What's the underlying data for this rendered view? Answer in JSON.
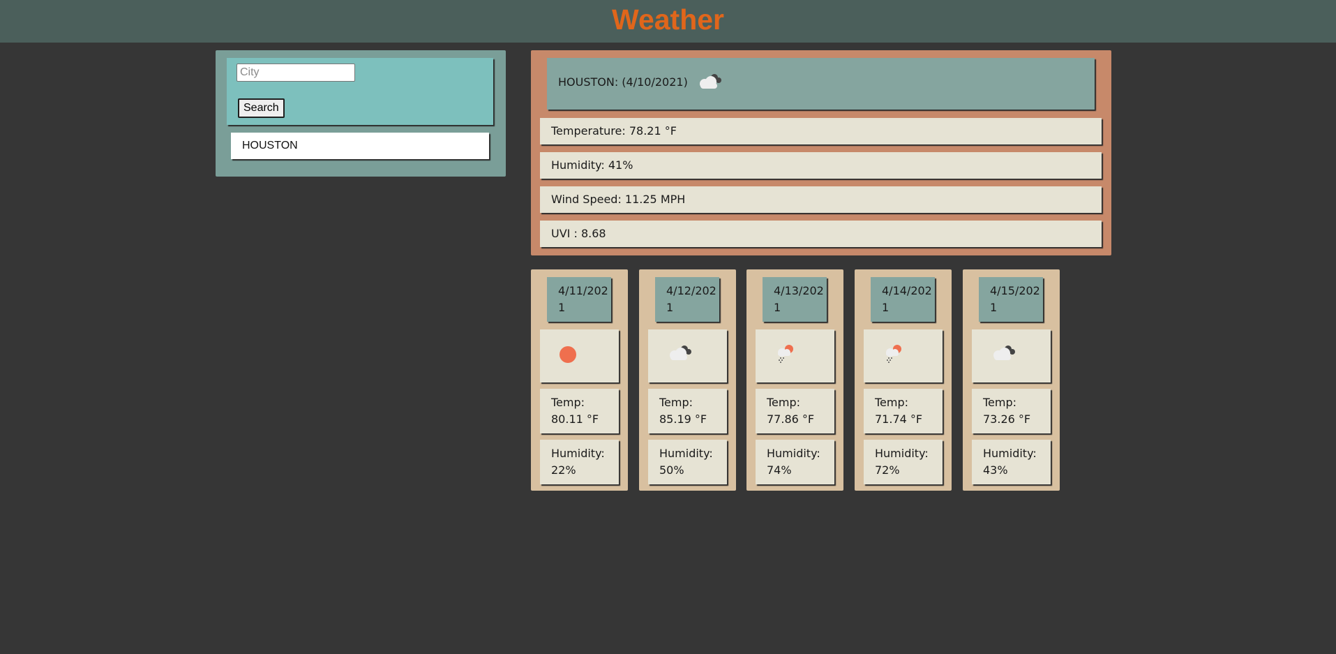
{
  "header": {
    "title": "Weather"
  },
  "search": {
    "placeholder": "City",
    "button_label": "Search"
  },
  "history": [
    "HOUSTON"
  ],
  "current": {
    "title": "HOUSTON: (4/10/2021)",
    "icon": "cloud-icon",
    "temperature": "Temperature: 78.21 °F",
    "humidity": "Humidity: 41%",
    "wind": "Wind Speed: 11.25 MPH",
    "uvi": "UVI : 8.68"
  },
  "forecast": [
    {
      "date": "4/11/2021",
      "icon": "sun-icon",
      "temp_label": "Temp:",
      "temp": "80.11 °F",
      "hum_label": "Humidity:",
      "humidity": "22%"
    },
    {
      "date": "4/12/2021",
      "icon": "cloud-icon",
      "temp_label": "Temp:",
      "temp": "85.19 °F",
      "hum_label": "Humidity:",
      "humidity": "50%"
    },
    {
      "date": "4/13/2021",
      "icon": "rain-sun-icon",
      "temp_label": "Temp:",
      "temp": "77.86 °F",
      "hum_label": "Humidity:",
      "humidity": "74%"
    },
    {
      "date": "4/14/2021",
      "icon": "rain-sun-icon",
      "temp_label": "Temp:",
      "temp": "71.74 °F",
      "hum_label": "Humidity:",
      "humidity": "72%"
    },
    {
      "date": "4/15/2021",
      "icon": "cloud-icon",
      "temp_label": "Temp:",
      "temp": "73.26 °F",
      "hum_label": "Humidity:",
      "humidity": "43%"
    }
  ],
  "colors": {
    "title": "#e0661b",
    "sun": "#ef6f4e",
    "cloud_light": "#eeeeee",
    "cloud_dark": "#444444"
  }
}
